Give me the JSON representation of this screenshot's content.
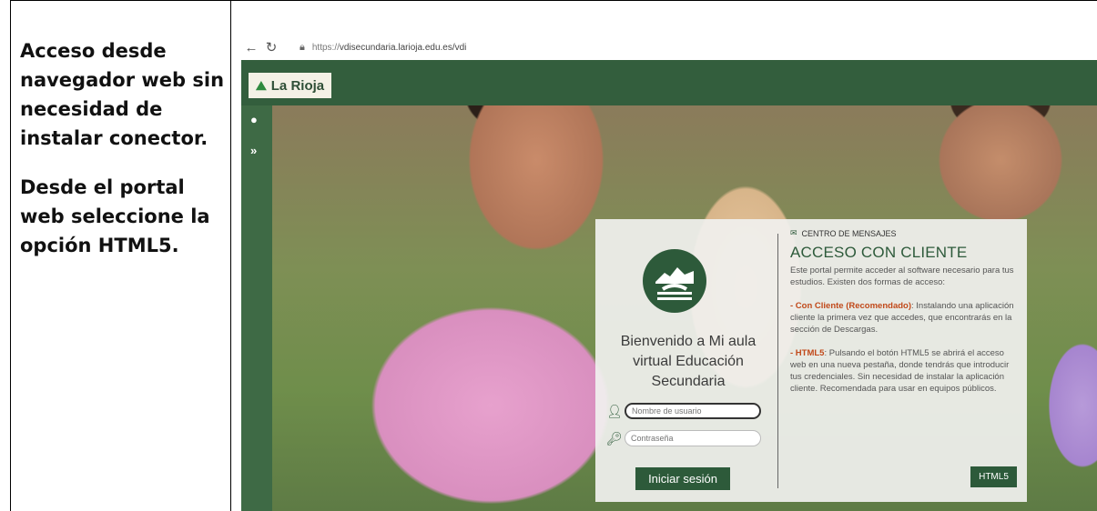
{
  "left_text": {
    "para1": "Acceso desde navegador web sin necesidad de instalar conector.",
    "para2": "Desde el portal web seleccione la opción HTML5."
  },
  "browser": {
    "back_icon": "arrow-left",
    "reload_icon": "reload",
    "lock_icon": "lock",
    "url_scheme": "https://",
    "url_rest": "vdisecundaria.larioja.edu.es/vdi"
  },
  "portal": {
    "brand": "La Rioja",
    "sidebar_icons": [
      "globe-icon",
      "double-chevron-right-icon"
    ],
    "welcome": "Bienvenido a Mi aula virtual Educación Secundaria",
    "username_placeholder": "Nombre de usuario",
    "password_placeholder": "Contraseña",
    "login_button": "Iniciar sesión",
    "messages_header": "CENTRO DE MENSAJES",
    "access_title": "ACCESO CON CLIENTE",
    "intro": "Este portal permite acceder al software necesario para tus estudios. Existen dos formas de acceso:",
    "client_label": "- Con Cliente (Recomendado)",
    "client_text": ": Instalando una aplicación cliente la primera vez que accedes, que encontrarás en la sección de Descargas.",
    "html5_label": "- HTML5",
    "html5_text": ": Pulsando el botón HTML5 se abrirá el acceso web en una nueva pestaña, donde tendrás que introducir tus credenciales. Sin necesidad de instalar la aplicación cliente. Recomendada para usar en equipos públicos.",
    "html5_button": "HTML5"
  },
  "colors": {
    "brand_green": "#2d5a3a",
    "accent_orange": "#c1491a"
  }
}
